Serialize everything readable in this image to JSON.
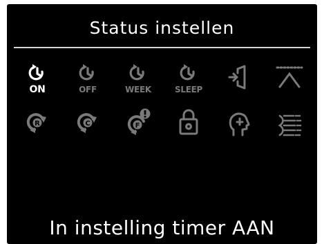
{
  "screen": {
    "title": "Status instellen",
    "status_text": "In instelling timer AAN"
  },
  "colors": {
    "background": "#000000",
    "active": "#ffffff",
    "inactive": "#7a7a7a",
    "divider": "#d8d8d8"
  },
  "icons": [
    {
      "name": "timer-on-icon",
      "caption": "ON",
      "active": true
    },
    {
      "name": "timer-off-icon",
      "caption": "OFF",
      "active": false
    },
    {
      "name": "timer-week-icon",
      "caption": "WEEK",
      "active": false
    },
    {
      "name": "timer-sleep-icon",
      "caption": "SLEEP",
      "active": false
    },
    {
      "name": "door-exit-icon",
      "caption": "",
      "active": false
    },
    {
      "name": "ceiling-airflow-icon",
      "caption": "",
      "active": false
    },
    {
      "name": "reset-r-icon",
      "caption": "",
      "active": false
    },
    {
      "name": "reset-c-icon",
      "caption": "",
      "active": false
    },
    {
      "name": "filter-alert-icon",
      "caption": "",
      "active": false
    },
    {
      "name": "settings-lock-icon",
      "caption": "",
      "active": false
    },
    {
      "name": "quiet-mode-icon",
      "caption": "",
      "active": false
    },
    {
      "name": "airflow-direction-icon",
      "caption": "",
      "active": false
    }
  ]
}
